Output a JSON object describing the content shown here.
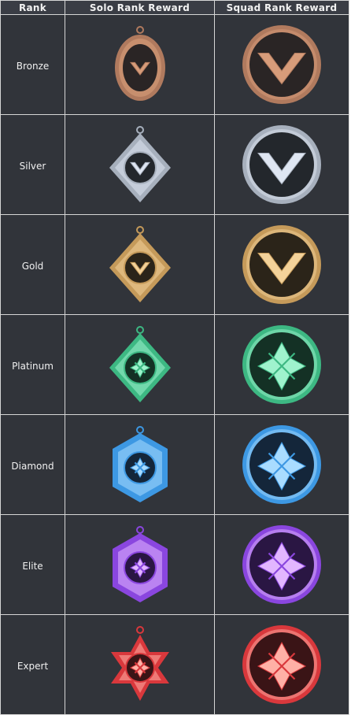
{
  "table": {
    "headers": [
      "Rank",
      "Solo Rank Reward",
      "Squad Rank Reward"
    ],
    "rows": [
      {
        "rank": "Bronze",
        "solo_icon": "bronze-pendant-icon",
        "squad_icon": "bronze-badge-icon",
        "colors": {
          "frame": "#b07a5e",
          "glow": "#d79c7a",
          "dark": "#2a2525"
        }
      },
      {
        "rank": "Silver",
        "solo_icon": "silver-pendant-icon",
        "squad_icon": "silver-badge-icon",
        "colors": {
          "frame": "#a7b0bd",
          "glow": "#dfe6f2",
          "dark": "#23272c"
        }
      },
      {
        "rank": "Gold",
        "solo_icon": "gold-pendant-icon",
        "squad_icon": "gold-badge-icon",
        "colors": {
          "frame": "#c59a5a",
          "glow": "#f3d29a",
          "dark": "#2b2419"
        }
      },
      {
        "rank": "Platinum",
        "solo_icon": "platinum-pendant-icon",
        "squad_icon": "platinum-badge-icon",
        "colors": {
          "frame": "#3db883",
          "glow": "#9ff3cd",
          "dark": "#143125"
        }
      },
      {
        "rank": "Diamond",
        "solo_icon": "diamond-pendant-icon",
        "squad_icon": "diamond-badge-icon",
        "colors": {
          "frame": "#3d98e3",
          "glow": "#a9dcff",
          "dark": "#14263a"
        }
      },
      {
        "rank": "Elite",
        "solo_icon": "elite-pendant-icon",
        "squad_icon": "elite-badge-icon",
        "colors": {
          "frame": "#8a46df",
          "glow": "#e2b6ff",
          "dark": "#2a1643"
        }
      },
      {
        "rank": "Expert",
        "solo_icon": "expert-pendant-icon",
        "squad_icon": "expert-badge-icon",
        "colors": {
          "frame": "#d9383c",
          "glow": "#ffb0a6",
          "dark": "#3a1416"
        }
      }
    ]
  }
}
